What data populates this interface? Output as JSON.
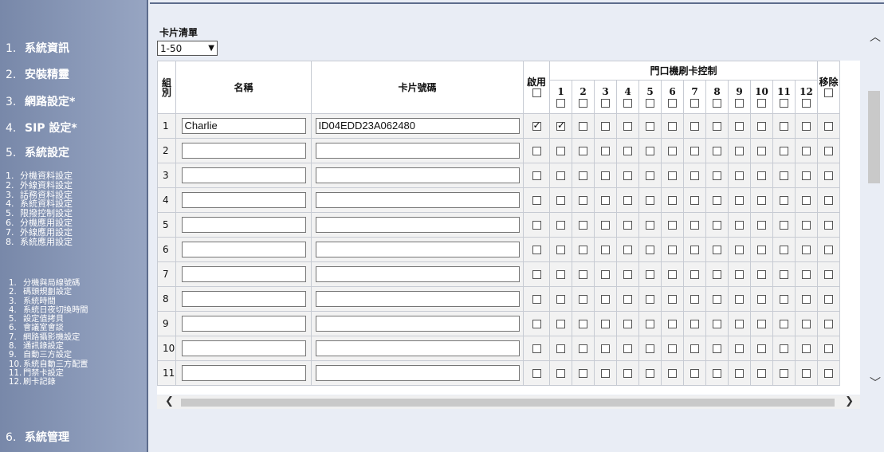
{
  "sidebar": {
    "top": [
      {
        "num": "1.",
        "label": "系統資訊"
      },
      {
        "num": "2.",
        "label": "安裝精靈"
      },
      {
        "num": "3.",
        "label": "網路設定*"
      },
      {
        "num": "4.",
        "label": "SIP 設定*"
      },
      {
        "num": "5.",
        "label": "系統設定"
      }
    ],
    "sub": [
      {
        "num": "1.",
        "label": "分機資料設定"
      },
      {
        "num": "2.",
        "label": "外線資料設定"
      },
      {
        "num": "3.",
        "label": "話務資料設定"
      },
      {
        "num": "4.",
        "label": "系統資料設定"
      },
      {
        "num": "5.",
        "label": "限撥控制設定"
      },
      {
        "num": "6.",
        "label": "分機應用設定"
      },
      {
        "num": "7.",
        "label": "外線應用設定"
      },
      {
        "num": "8.",
        "label": "系統應用設定"
      }
    ],
    "subsub": [
      {
        "num": "1.",
        "label": "分機與局線號碼"
      },
      {
        "num": "2.",
        "label": "碼頭規劃設定"
      },
      {
        "num": "3.",
        "label": "系統時間"
      },
      {
        "num": "4.",
        "label": "系統日夜切換時間"
      },
      {
        "num": "5.",
        "label": "設定值拷貝"
      },
      {
        "num": "6.",
        "label": "會議室會談"
      },
      {
        "num": "7.",
        "label": "網路攝影機設定"
      },
      {
        "num": "8.",
        "label": "通訊錄設定"
      },
      {
        "num": "9.",
        "label": "自動三方設定"
      },
      {
        "num": "10.",
        "label": "系統自動三方配置"
      },
      {
        "num": "11.",
        "label": "門禁卡設定"
      },
      {
        "num": "12.",
        "label": "刷卡記錄"
      }
    ],
    "last": {
      "num": "6.",
      "label": "系統管理"
    }
  },
  "main": {
    "title": "卡片清單",
    "range_select": "1-50",
    "headers": {
      "group": "組別",
      "name": "名稱",
      "card_no": "卡片號碼",
      "enable": "啟用",
      "door_control": "門口機刷卡控制",
      "remove": "移除",
      "door_numbers": [
        "1",
        "2",
        "3",
        "4",
        "5",
        "6",
        "7",
        "8",
        "9",
        "10",
        "11",
        "12"
      ]
    },
    "rows": [
      {
        "num": "1",
        "name": "Charlie",
        "card": "ID04EDD23A062480",
        "enabled": true,
        "doors": [
          true,
          false,
          false,
          false,
          false,
          false,
          false,
          false,
          false,
          false,
          false,
          false
        ],
        "remove": false
      },
      {
        "num": "2",
        "name": "",
        "card": "",
        "enabled": false,
        "doors": [
          false,
          false,
          false,
          false,
          false,
          false,
          false,
          false,
          false,
          false,
          false,
          false
        ],
        "remove": false
      },
      {
        "num": "3",
        "name": "",
        "card": "",
        "enabled": false,
        "doors": [
          false,
          false,
          false,
          false,
          false,
          false,
          false,
          false,
          false,
          false,
          false,
          false
        ],
        "remove": false
      },
      {
        "num": "4",
        "name": "",
        "card": "",
        "enabled": false,
        "doors": [
          false,
          false,
          false,
          false,
          false,
          false,
          false,
          false,
          false,
          false,
          false,
          false
        ],
        "remove": false
      },
      {
        "num": "5",
        "name": "",
        "card": "",
        "enabled": false,
        "doors": [
          false,
          false,
          false,
          false,
          false,
          false,
          false,
          false,
          false,
          false,
          false,
          false
        ],
        "remove": false
      },
      {
        "num": "6",
        "name": "",
        "card": "",
        "enabled": false,
        "doors": [
          false,
          false,
          false,
          false,
          false,
          false,
          false,
          false,
          false,
          false,
          false,
          false
        ],
        "remove": false
      },
      {
        "num": "7",
        "name": "",
        "card": "",
        "enabled": false,
        "doors": [
          false,
          false,
          false,
          false,
          false,
          false,
          false,
          false,
          false,
          false,
          false,
          false
        ],
        "remove": false
      },
      {
        "num": "8",
        "name": "",
        "card": "",
        "enabled": false,
        "doors": [
          false,
          false,
          false,
          false,
          false,
          false,
          false,
          false,
          false,
          false,
          false,
          false
        ],
        "remove": false
      },
      {
        "num": "9",
        "name": "",
        "card": "",
        "enabled": false,
        "doors": [
          false,
          false,
          false,
          false,
          false,
          false,
          false,
          false,
          false,
          false,
          false,
          false
        ],
        "remove": false
      },
      {
        "num": "10",
        "name": "",
        "card": "",
        "enabled": false,
        "doors": [
          false,
          false,
          false,
          false,
          false,
          false,
          false,
          false,
          false,
          false,
          false,
          false
        ],
        "remove": false
      },
      {
        "num": "11",
        "name": "",
        "card": "",
        "enabled": false,
        "doors": [
          false,
          false,
          false,
          false,
          false,
          false,
          false,
          false,
          false,
          false,
          false,
          false
        ],
        "remove": false
      }
    ]
  },
  "icons": {
    "scroll_up": "chevron-up-icon",
    "scroll_down": "chevron-down-icon",
    "scroll_left": "chevron-left-icon",
    "scroll_right": "chevron-right-icon",
    "checkmark": "check-icon"
  },
  "colors": {
    "sidebar": "#8b9ab9",
    "page_bg": "#e9edf5",
    "row_bg": "#f2f2f2"
  }
}
